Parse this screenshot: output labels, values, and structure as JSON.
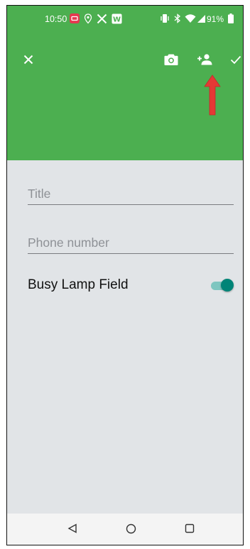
{
  "status_bar": {
    "time": "10:50",
    "battery": "91%"
  },
  "toolbar": {
    "close_icon": "close-icon",
    "camera_icon": "camera-icon",
    "add_contact_icon": "person-add-icon",
    "save_icon": "check-icon"
  },
  "form": {
    "title_placeholder": "Title",
    "title_value": "",
    "phone_placeholder": "Phone number",
    "phone_value": "",
    "blf_label": "Busy Lamp Field",
    "blf_enabled": true
  },
  "annotation": {
    "arrow_color": "#e53935",
    "points_to": "add contact button"
  },
  "colors": {
    "appbar": "#4caf50",
    "background": "#e1e4e7",
    "switch_on": "#008477"
  }
}
